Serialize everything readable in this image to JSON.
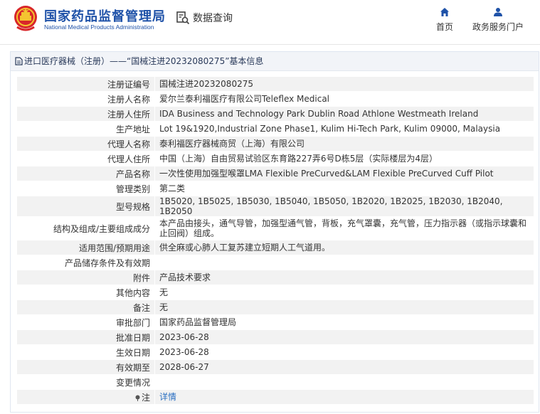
{
  "header": {
    "logo_name": "national-emblem",
    "title_cn": "国家药品监督管理局",
    "title_en": "National Medical Products Administration",
    "data_query_label": "数据查询",
    "nav": [
      {
        "label": "首页",
        "icon": "home-icon"
      },
      {
        "label": "政务服务门户",
        "icon": "user-icon"
      }
    ]
  },
  "panel": {
    "title": "进口医疗器械（注册）——“国械注进20232080275”基本信息"
  },
  "rows": [
    {
      "label": "注册证编号",
      "value": "国械注进20232080275"
    },
    {
      "label": "注册人名称",
      "value": "爱尔兰泰利福医疗有限公司Teleflex Medical"
    },
    {
      "label": "注册人住所",
      "value": "IDA Business and Technology Park Dublin Road Athlone Westmeath Ireland"
    },
    {
      "label": "生产地址",
      "value": "Lot 19&1920,Industrial Zone Phase1, Kulim Hi-Tech Park, Kulim 09000, Malaysia"
    },
    {
      "label": "代理人名称",
      "value": "泰利福医疗器械商贸（上海）有限公司"
    },
    {
      "label": "代理人住所",
      "value": "中国（上海）自由贸易试验区东育路227弄6号D栋5层（实际楼层为4层）"
    },
    {
      "label": "产品名称",
      "value": "一次性使用加强型喉罩LMA Flexible PreCurved&LAM Flexible PreCurved Cuff Pilot"
    },
    {
      "label": "管理类别",
      "value": "第二类"
    },
    {
      "label": "型号规格",
      "value": "1B5020, 1B5025, 1B5030, 1B5040, 1B5050, 1B2020, 1B2025, 1B2030, 1B2040, 1B2050"
    },
    {
      "label": "结构及组成/主要组成成分",
      "value": "本产品由接头，通气导管，加强型通气管，背板，充气罩囊，充气管，压力指示器（或指示球囊和止回阀）组成。"
    },
    {
      "label": "适用范围/预期用途",
      "value": "供全麻或心肺人工复苏建立短期人工气道用。"
    },
    {
      "label": "产品储存条件及有效期",
      "value": ""
    },
    {
      "label": "附件",
      "value": "产品技术要求"
    },
    {
      "label": "其他内容",
      "value": "无"
    },
    {
      "label": "备注",
      "value": "无"
    },
    {
      "label": "审批部门",
      "value": "国家药品监督管理局"
    },
    {
      "label": "批准日期",
      "value": "2023-06-28"
    },
    {
      "label": "生效日期",
      "value": "2023-06-28"
    },
    {
      "label": "有效期至",
      "value": "2028-06-27"
    },
    {
      "label": "变更情况",
      "value": ""
    }
  ],
  "note_row": {
    "label": "注",
    "link_text": "详情"
  }
}
